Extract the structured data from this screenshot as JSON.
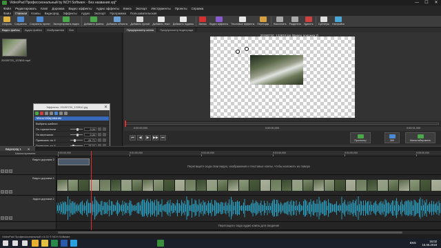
{
  "window": {
    "title": "VideoPad Профессиональный by NCH Software - Без названия.vpj*",
    "minimize_glyph": "—",
    "maximize_glyph": "☐",
    "close_glyph": "✕"
  },
  "menubar": [
    "Файл",
    "Редактировать",
    "Клип",
    "Дорожка",
    "Видео эффекты",
    "Аудио эффекты",
    "Книга",
    "Экспорт",
    "Инструменты",
    "Проекты",
    "Справка"
  ],
  "ribbon_tabs": {
    "items": [
      "Файл",
      "Главная",
      "Клипы",
      "Видеоряд",
      "Эффекты",
      "Аудио",
      "Экспорт",
      "Программа",
      "Пользовательская"
    ],
    "active_index": 1
  },
  "toolbar": [
    {
      "label": "Открыть",
      "icon": "folder-icon",
      "color": "#e0b040"
    },
    {
      "label": "Сохранить",
      "icon": "save-icon",
      "color": "#4a8ad4"
    },
    {
      "label": "Сохранить проект",
      "icon": "save-project-icon",
      "color": "#4a8ad4"
    },
    {
      "label": "Экспортировать видео",
      "icon": "export-video-icon",
      "color": "#4aa84a"
    },
    {
      "label": "Добавить файлы",
      "icon": "add-files-icon",
      "color": "#4aa84a"
    },
    {
      "label": "Добавить объекты",
      "icon": "add-objects-icon",
      "color": "#6aa0d8"
    },
    {
      "label": "Добавить пустой",
      "icon": "add-blank-icon",
      "color": "#d8d8d8"
    },
    {
      "label": "Добавить текст",
      "icon": "add-text-icon",
      "color": "#e8e8e8"
    },
    {
      "label": "Добавить подпись",
      "icon": "add-caption-icon",
      "color": "#e8e8e8"
    },
    {
      "label": "Запись",
      "icon": "record-icon",
      "color": "#d83030"
    },
    {
      "label": "Видео эффекты",
      "icon": "video-effects-icon",
      "color": "#8a5ad0"
    },
    {
      "label": "Текстовые эффекты",
      "icon": "text-effects-icon",
      "color": "#e8e8e8"
    },
    {
      "label": "Переходы",
      "icon": "transitions-icon",
      "color": "#d8a040"
    },
    {
      "label": "Выполнить",
      "icon": "undo-icon",
      "color": "#aaaaaa"
    },
    {
      "label": "Разделить",
      "icon": "split-icon",
      "color": "#aaaaaa"
    },
    {
      "label": "Удалить",
      "icon": "delete-icon",
      "color": "#d04040"
    },
    {
      "label": "Субтитры",
      "icon": "subtitles-icon",
      "color": "#e0e0e0"
    },
    {
      "label": "Настройки",
      "icon": "settings-icon",
      "color": "#4aa8d8"
    }
  ],
  "files_panel": {
    "tabs": [
      "Видео файлы",
      "Аудио файлы",
      "Изображения",
      "Все"
    ],
    "active_tab": 0,
    "file_name": "20190720_122810.mp4"
  },
  "effects_dialog": {
    "title": "Эффекты: 20190720_122810.jpg",
    "close_glyph": "✕",
    "section": "Масштабирование",
    "rows": [
      {
        "label": "Выбрать шаблон",
        "value": "",
        "knob": null
      },
      {
        "label": "По горизонтали",
        "value": "0.34",
        "knob": 0.55
      },
      {
        "label": "По вертикали",
        "value": "0.34",
        "knob": 0.55
      },
      {
        "label": "Привязать по X",
        "value": "-61.71",
        "knob": 0.3
      },
      {
        "label": "Привязать по Y",
        "value": "-95.54",
        "knob": 0.2
      },
      {
        "label": "Сдвиг X",
        "value": "97.31",
        "knob": 0.8
      },
      {
        "label": "Сдвиг Y",
        "value": "57.94",
        "knob": 0.7
      },
      {
        "label": "Поддерживать AR",
        "value": "",
        "knob": null,
        "checked": true
      }
    ]
  },
  "preview": {
    "tabs": [
      "Предпросмотр клипа",
      "Предпросмотр видеоряда"
    ],
    "active_tab": 0,
    "caption": "20190720_122810.jpg (Видео дорожка 2)",
    "time_start": "0:00:00,000",
    "time_mid": "0:00:00,000",
    "time_end": "0:00:01,000",
    "transport_glyphs": [
      "⏮",
      "◀",
      "▶",
      "▶▶",
      "⏭"
    ],
    "buttons": [
      {
        "label": "Просмотр",
        "icon": "preview-icon",
        "color": "#4aa84a"
      },
      {
        "label": "360",
        "icon": "360-icon",
        "color": "#4a8ad4"
      },
      {
        "label": "Масштабировать",
        "icon": "zoom-icon",
        "color": "#4aa84a"
      }
    ]
  },
  "timeline": {
    "tab": "Видеоряд 1",
    "tab_close": "✕",
    "ruler_label": "Шкала времени",
    "ruler_ticks": [
      "0:00:00,000",
      "0:01:00,000",
      "0:02:00,000",
      "0:03:00,000",
      "0:04:00,000",
      "0:05:00,000"
    ],
    "tracks": [
      {
        "name": "Видео дорожка 2",
        "drop_text": "Перетащите сюда свои видео, изображения и текстовые клипы, чтобы наложить их поверх"
      },
      {
        "name": "Видео дорожка 1"
      },
      {
        "name": "Аудио дорожка 1"
      }
    ],
    "audio_drop_text": "Перетащите сюда аудио клипы для сведения",
    "colors": {
      "playhead": "#e03030",
      "waveform": "#2a9fc0",
      "clip_bg": "#5a6a5a"
    }
  },
  "statusbar": "VideoPad Профессиональный v 6.22 © NCH Software",
  "taskbar": {
    "lang": "ENG",
    "time": "16:02",
    "date": "15.06.2019",
    "icons": [
      {
        "name": "windows-start-icon",
        "color": "#ffffff"
      },
      {
        "name": "search-icon",
        "color": "#ffffff"
      },
      {
        "name": "taskview-icon",
        "color": "#ffffff"
      },
      {
        "name": "chrome-icon",
        "color": "#e8b030"
      },
      {
        "name": "explorer-icon",
        "color": "#e0c040"
      },
      {
        "name": "excel-icon",
        "color": "#2a8a4a"
      },
      {
        "name": "word-icon",
        "color": "#2a5aaa"
      },
      {
        "name": "skype-icon",
        "color": "#2aa0e0"
      },
      {
        "name": "videopad-icon",
        "color": "#3a8e3a"
      }
    ]
  }
}
